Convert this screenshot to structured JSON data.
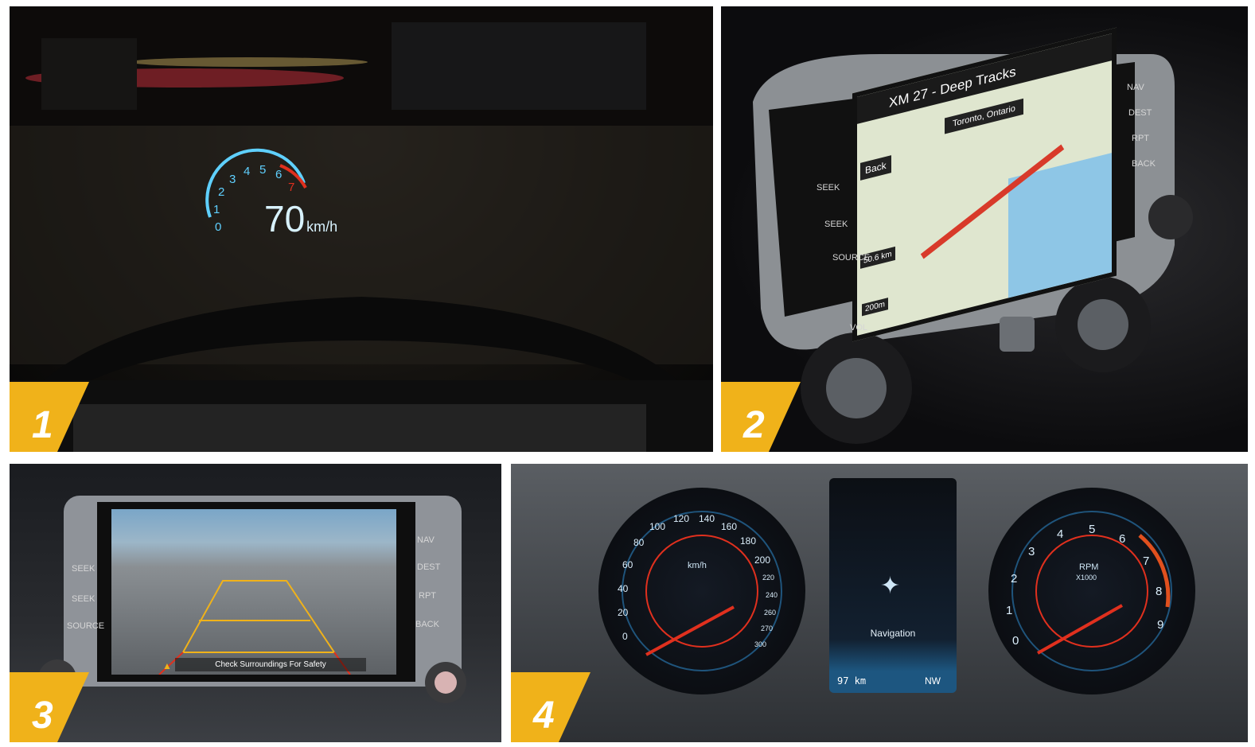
{
  "panels": [
    {
      "number": "1",
      "hud": {
        "speed": "70",
        "unit": "km/h",
        "gauge_ticks": [
          "0",
          "1",
          "2",
          "3",
          "4",
          "5",
          "6",
          "7"
        ]
      }
    },
    {
      "number": "2",
      "screen": {
        "station": "XM 27 - Deep Tracks",
        "location": "Toronto, Ontario",
        "back": "Back",
        "distance": "50.6 km",
        "scale": "200m"
      },
      "side_buttons_left": [
        "SEEK",
        "SEEK",
        "SOURCE"
      ],
      "side_buttons_right": [
        "NAV",
        "DEST",
        "RPT",
        "BACK"
      ],
      "knob_label": "VOL"
    },
    {
      "number": "3",
      "screen": {
        "warning": "Check Surroundings For Safety"
      },
      "side_buttons_left": [
        "SEEK",
        "SEEK",
        "SOURCE"
      ],
      "side_buttons_right": [
        "NAV",
        "DEST",
        "RPT",
        "BACK"
      ]
    },
    {
      "number": "4",
      "speedometer": {
        "unit": "km/h",
        "ticks": [
          "0",
          "20",
          "40",
          "60",
          "80",
          "100",
          "120",
          "140",
          "160",
          "180",
          "200",
          "220",
          "240",
          "260",
          "270",
          "300"
        ]
      },
      "info": {
        "label": "Navigation",
        "distance": "97 km",
        "heading": "NW"
      },
      "tachometer": {
        "label": "RPM",
        "multiplier": "X1000",
        "ticks": [
          "0",
          "1",
          "2",
          "3",
          "4",
          "5",
          "6",
          "7",
          "8",
          "9"
        ]
      }
    }
  ],
  "colors": {
    "badge": "#f0b21a",
    "hud": "#5fd0ff",
    "redline": "#e0301e"
  }
}
